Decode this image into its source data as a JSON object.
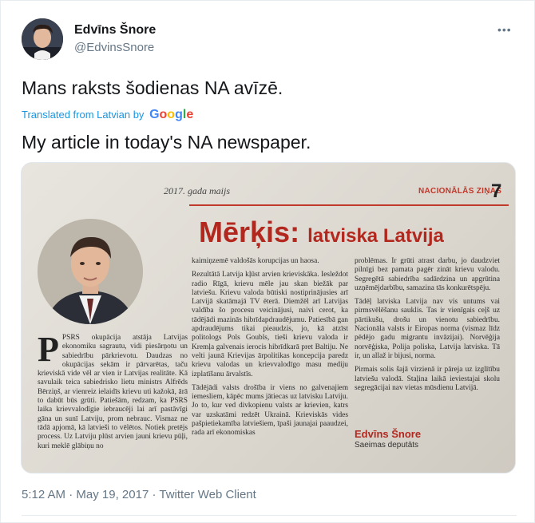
{
  "author": {
    "name": "Edvīns Šnore",
    "handle": "@EdvinsSnore"
  },
  "more_icon": "•••",
  "tweet": {
    "text": "Mans raksts šodienas NA avīzē.",
    "translated_prefix": "Translated from Latvian by",
    "translated_brand": "Google",
    "translated_text": "My article in today's NA newspaper."
  },
  "newspaper": {
    "date": "2017. gada maijs",
    "section": "NACIONĀLĀS ZIŅAS",
    "page_number": "7",
    "headline_main": "Mērķis:",
    "headline_sub": "latviska Latvija",
    "col1": [
      "PSRS okupācija atstāja Latvijas ekonomiku sagrautu, vidi piesārņotu un sabiedrību pārkrievotu. Daudzas no okupācijas sekām ir pārvarētas, taču krieviskā vide vēl ar vien ir Latvijas realitāte. Kā savulaik teica sabiedrisko lietu ministrs Alfrēds Bērziņš, ar vienreiz ielaidīs krievu uti kažokā, ārā to dabūt būs grūti. Patiešām, redzam, ka PSRS laika krievvalodīgie iebraucēji lai arī pastāvīgi gāna un sunī Latviju, prom nebrauc. Vismaz ne tādā apjomā, kā latvieši to vēlētos. Notiek pretējs process. Uz Latviju plūst arvien jauni krievu pūļi, kuri meklē glābiņu no"
    ],
    "col2": [
      "kaimiņzemē valdošās korupcijas un haosa.",
      "Rezultātā Latvija kļūst arvien krieviskāka. Iesleždot radio Rīgā, krievu mēle jau skan biežāk par latviešu. Krievu valoda būtiski nostiprinājusies arī Latvijā skatāmajā TV ēterā. Diemžēl arī Latvijas valdība šo procesu veicinājusi, naivi cerot, ka tādējādi mazinās hibrīdapdraudējumu. Patiesībā gan apdraudējums tikai pieaudzis, jo, kā atzīst politologs Pols Goubls, tieši krievu valoda ir Kremļa galvenais ierocis hibrīdkarā pret Baltiju. Ne velti jaunā Krievijas ārpolitikas koncepcija paredz krievu valodas un krievvalodīgo masu mediju izplatīšanu ārvalstīs.",
      "Tādējādi valsts drošība ir viens no galvenajiem iemesliem, kāpēc mums jātiecas uz latvisku Latviju. Jo to, kur ved divkopienu valsts ar krievien, katrs var uzskatāmi redzēt Ukrainā. Krieviskās vides pašpietiekamība latviešiem, īpaši jaunajai paaudzei, rada arī ekonomiskas"
    ],
    "col3": [
      "problēmas. Ir grūti atrast darbu, jo daudzviet pilnīgi bez pamata pagēr zināt krievu valodu. Segregētā sabiedrība sadārdzina un apgrūtina uzņēmējdarbību, samazina tās konkurētspēju.",
      "Tādēļ latviska Latvija nav vis untums vai pirmsvēlēšanu sauklis. Tas ir vienīgais ceļš uz pārtikušu, drošu un vienotu sabiedrību. Nacionāla valsts ir Eiropas norma (vismaz līdz pēdējo gadu migrantu invāzijai). Norvēģija norvēģiska, Polija poliska, Latvija latviska. Tā ir, un allaž ir bijusi, norma.",
      "Pirmais solis šajā virzienā ir pāreja uz izglītību latviešu valodā. Staļina laikā ieviestajai skolu segregācijai nav vietas mūsdienu Latvijā."
    ],
    "signature_name": "Edvīns Šnore",
    "signature_role": "Saeimas deputāts"
  },
  "meta": {
    "time": "5:12 AM",
    "sep1": "·",
    "date": "May 19, 2017",
    "sep2": "·",
    "client": "Twitter Web Client"
  },
  "colors": {
    "link": "#1b95e0",
    "muted": "#657786",
    "headline": "#b3281e"
  }
}
